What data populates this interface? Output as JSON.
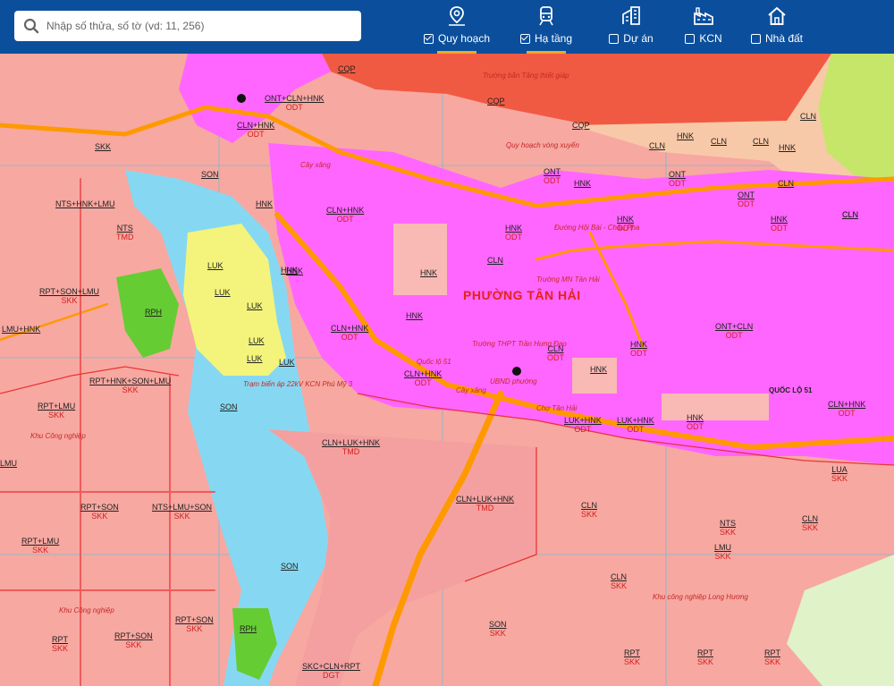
{
  "search": {
    "placeholder": "Nhập số thửa, số tờ (vd: 11, 256)"
  },
  "layers": [
    {
      "name": "Quy hoạch",
      "icon": "map-pin-icon",
      "checked": true,
      "active": true
    },
    {
      "name": "Hạ tầng",
      "icon": "train-icon",
      "checked": true,
      "active": true
    },
    {
      "name": "Dự án",
      "icon": "buildings-icon",
      "checked": false,
      "active": false
    },
    {
      "name": "KCN",
      "icon": "factory-icon",
      "checked": false,
      "active": false
    },
    {
      "name": "Nhà đất",
      "icon": "home-icon",
      "checked": false,
      "active": false
    }
  ],
  "colors": {
    "header": "#0b4f9c",
    "accent": "#f5a623",
    "skk": "#f7a8a1",
    "odt": "#ff66ff",
    "dgt": "#ff9900",
    "son": "#86d8f2",
    "luk": "#f4f47c",
    "rph": "#66cc33",
    "cqp": "#f15a42",
    "cln": "#f8c9a8",
    "tmd": "#f5a0a0"
  },
  "map": {
    "ward_name": "PHƯỜNG TÂN HẢI",
    "labels": [
      {
        "top": "CQP",
        "bottom": ""
      },
      {
        "top": "CQP",
        "bottom": ""
      },
      {
        "top": "CQP",
        "bottom": ""
      },
      {
        "top": "CLN",
        "bottom": ""
      },
      {
        "top": "CLN",
        "bottom": ""
      },
      {
        "top": "CLN",
        "bottom": ""
      },
      {
        "top": "HNK",
        "bottom": ""
      },
      {
        "top": "HNK",
        "bottom": ""
      },
      {
        "top": "CLN",
        "bottom": ""
      },
      {
        "top": "CLN",
        "bottom": ""
      },
      {
        "top": "SKK",
        "bottom": ""
      },
      {
        "top": "NTS+HNK+LMU",
        "bottom": ""
      },
      {
        "top": "NTS",
        "bottom": "TMD"
      },
      {
        "top": "RPT+SON+LMU",
        "bottom": "SKK"
      },
      {
        "top": "RPH",
        "bottom": ""
      },
      {
        "top": "LMU+HNK",
        "bottom": ""
      },
      {
        "top": "RPT+HNK+SON+LMU",
        "bottom": "SKK"
      },
      {
        "top": "RPT+LMU",
        "bottom": "SKK"
      },
      {
        "top": "LMU",
        "bottom": ""
      },
      {
        "top": "RPT+SON",
        "bottom": "SKK"
      },
      {
        "top": "NTS+LMU+SON",
        "bottom": "SKK"
      },
      {
        "top": "RPT+LMU",
        "bottom": "SKK"
      },
      {
        "top": "RPT",
        "bottom": "SKK"
      },
      {
        "top": "RPT+SON",
        "bottom": "SKK"
      },
      {
        "top": "RPT+SON",
        "bottom": "SKK"
      },
      {
        "top": "RPH",
        "bottom": ""
      },
      {
        "top": "LUK",
        "bottom": ""
      },
      {
        "top": "LUK",
        "bottom": ""
      },
      {
        "top": "LUK",
        "bottom": ""
      },
      {
        "top": "LUK",
        "bottom": ""
      },
      {
        "top": "LUK",
        "bottom": ""
      },
      {
        "top": "LUK",
        "bottom": ""
      },
      {
        "top": "SON",
        "bottom": ""
      },
      {
        "top": "SON",
        "bottom": ""
      },
      {
        "top": "SON",
        "bottom": ""
      },
      {
        "top": "CLN+LUK+HNK",
        "bottom": "TMD"
      },
      {
        "top": "CLN+LUK+HNK",
        "bottom": "TMD"
      },
      {
        "top": "CLN",
        "bottom": "SKK"
      },
      {
        "top": "NTS",
        "bottom": "SKK"
      },
      {
        "top": "CLN",
        "bottom": "SKK"
      },
      {
        "top": "LMU",
        "bottom": "SKK"
      },
      {
        "top": "CLN",
        "bottom": "SKK"
      },
      {
        "top": "LUA",
        "bottom": "SKK"
      },
      {
        "top": "SON",
        "bottom": "SKK"
      },
      {
        "top": "RPT",
        "bottom": "SKK"
      },
      {
        "top": "RPT",
        "bottom": "SKK"
      },
      {
        "top": "RPT",
        "bottom": "SKK"
      },
      {
        "top": "CLN+HNK",
        "bottom": "ODT"
      },
      {
        "top": "CLN+HNK",
        "bottom": "ODT"
      },
      {
        "top": "CLN+HNK",
        "bottom": "ODT"
      },
      {
        "top": "ONT+CLN+HNK",
        "bottom": "ODT"
      },
      {
        "top": "CLN+HNK",
        "bottom": "ODT"
      },
      {
        "top": "LUK+HNK",
        "bottom": "ODT"
      },
      {
        "top": "CLN+HNK",
        "bottom": "ODT"
      },
      {
        "top": "HNK",
        "bottom": "ODT"
      },
      {
        "top": "HNK",
        "bottom": ""
      },
      {
        "top": "HNK",
        "bottom": ""
      },
      {
        "top": "HNK",
        "bottom": ""
      },
      {
        "top": "CLN",
        "bottom": ""
      },
      {
        "top": "HNK",
        "bottom": ""
      },
      {
        "top": "ONT",
        "bottom": "ODT"
      },
      {
        "top": "ONT",
        "bottom": "ODT"
      },
      {
        "top": "ONT",
        "bottom": "ODT"
      },
      {
        "top": "HNK",
        "bottom": "ODT"
      },
      {
        "top": "ONT+CLN",
        "bottom": "ODT"
      },
      {
        "top": "HNK",
        "bottom": "ODT"
      },
      {
        "top": "CLN",
        "bottom": "ODT"
      },
      {
        "top": "HNK",
        "bottom": "ODT"
      },
      {
        "top": "HNK",
        "bottom": "ODT"
      },
      {
        "top": "LUK+HNK",
        "bottom": "ODT"
      },
      {
        "top": "SKC+CLN+RPT",
        "bottom": "DGT"
      },
      {
        "top": "HNK",
        "bottom": ""
      },
      {
        "top": "HNK",
        "bottom": ""
      },
      {
        "top": "CLN",
        "bottom": ""
      },
      {
        "top": "CLN",
        "bottom": ""
      },
      {
        "top": "HNK",
        "bottom": ""
      }
    ],
    "notes": [
      "Khu Công nghiệp",
      "Khu Công nghiệp",
      "Khu công nghiệp Long Hương",
      "Quốc lộ 51",
      "QUỐC LỘ 51",
      "Đường Hội Bài - Châu Pha",
      "Trường bắn Tăng thiết giáp",
      "Cây xăng",
      "Trạm biến áp 22kV KCN Phú Mỹ 3",
      "Cây xăng",
      "UBND phường",
      "Trường THPT Trần Hưng Đạo",
      "Chợ Tân Hải",
      "Quy hoạch vòng xuyến",
      "Trường MN Tân Hải"
    ]
  }
}
